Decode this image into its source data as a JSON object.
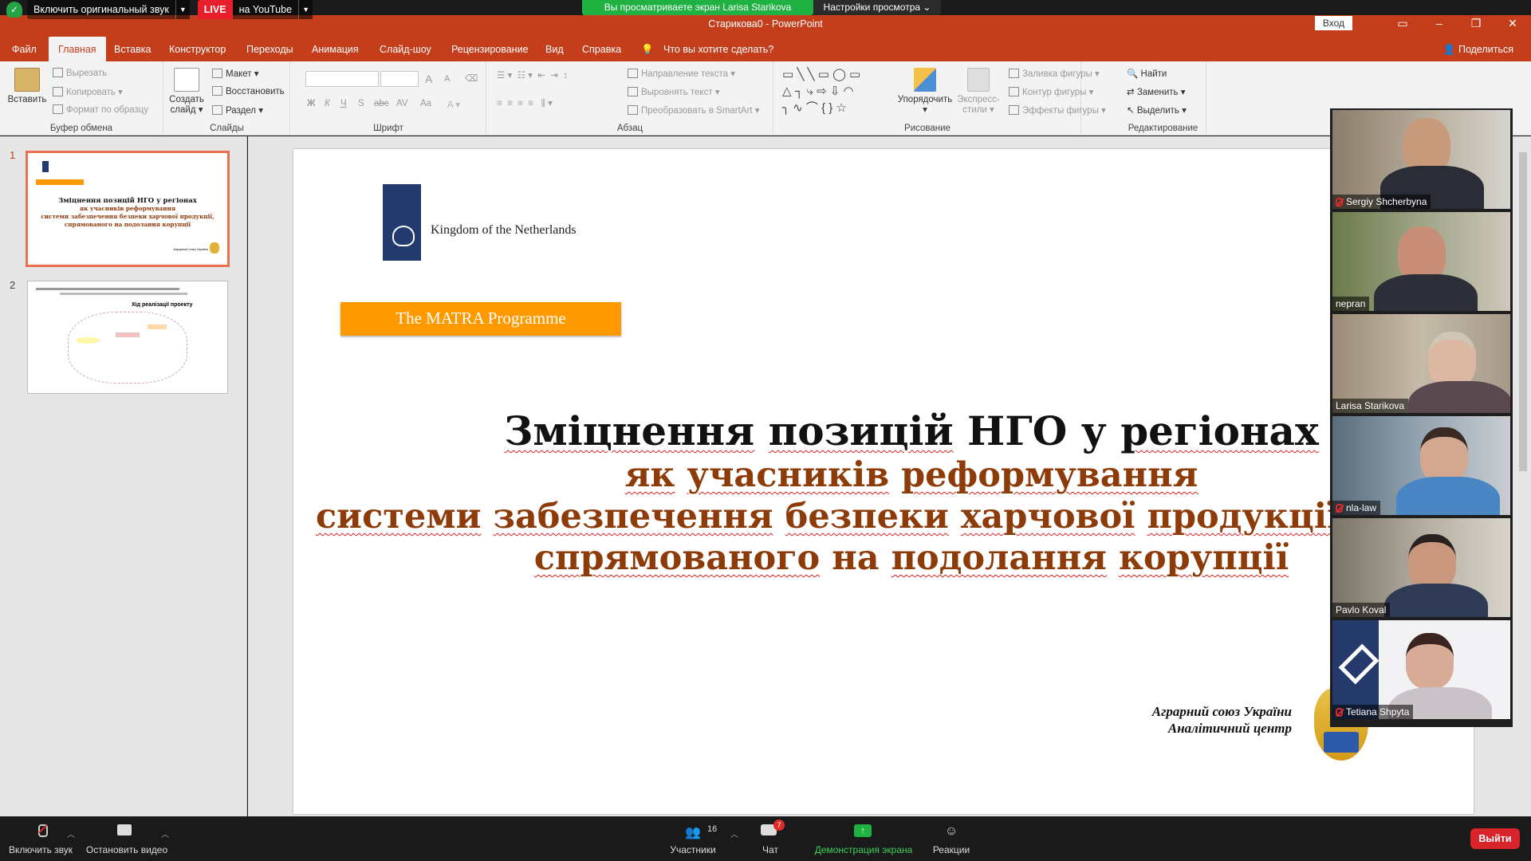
{
  "zoom_banner": {
    "viewing": "Вы просматриваете экран Larisa Starikova",
    "view_options": "Настройки просмотра"
  },
  "zoom_overlay": {
    "original_sound": "Включить оригинальный звук",
    "live": "LIVE",
    "youtube": "на YouTube"
  },
  "titlebar": {
    "doc_title": "Старикова0  -  PowerPoint",
    "signin": "Вход",
    "right_cut": "Вид"
  },
  "tabs": [
    {
      "label": "Файл"
    },
    {
      "label": "Главная"
    },
    {
      "label": "Вставка"
    },
    {
      "label": "Конструктор"
    },
    {
      "label": "Переходы"
    },
    {
      "label": "Анимация"
    },
    {
      "label": "Слайд-шоу"
    },
    {
      "label": "Рецензирование"
    },
    {
      "label": "Вид"
    },
    {
      "label": "Справка"
    },
    {
      "label": "Что вы хотите сделать?"
    }
  ],
  "share": "Поделиться",
  "ribbon": {
    "clipboard": {
      "label": "Буфер обмена",
      "paste": "Вставить",
      "cut": "Вырезать",
      "copy": "Копировать",
      "format": "Формат по образцу"
    },
    "slides": {
      "label": "Слайды",
      "new_slide": "Создать слайд",
      "layout": "Макет",
      "reset": "Восстановить",
      "section": "Раздел"
    },
    "font": {
      "label": "Шрифт",
      "bold": "Ж",
      "italic": "К",
      "underline": "Ч",
      "shadow": "S",
      "strike": "abc",
      "spacing": "AV",
      "case": "Aa",
      "grow": "A",
      "shrink": "A"
    },
    "paragraph": {
      "label": "Абзац",
      "direction": "Направление текста",
      "align": "Выровнять текст",
      "smartart": "Преобразовать в SmartArt"
    },
    "drawing": {
      "label": "Рисование",
      "arrange": "Упорядочить",
      "styles": "Экспресс-стили",
      "fill": "Заливка фигуры",
      "outline": "Контур фигуры",
      "effects": "Эффекты фигуры"
    },
    "editing": {
      "label": "Редактирование",
      "find": "Найти",
      "replace": "Заменить",
      "select": "Выделить"
    }
  },
  "thumbnails": [
    {
      "num": "1",
      "title": "Зміцнення позицій НГО у регіонах",
      "sub1": "як учасників реформування",
      "sub2": "системи забезпечення безпеки харчової продукції,",
      "sub3": "спрямованого на подолання корупції",
      "org": "Аграрний союз України"
    },
    {
      "num": "2",
      "text": "Хід реалізації проекту"
    }
  ],
  "slide": {
    "nl_text": "Kingdom of the Netherlands",
    "matra": "The MATRA Programme",
    "title_w": [
      "Зміцнення",
      "позицій",
      "НГО",
      "у",
      "регіонах"
    ],
    "line2_w": [
      "як",
      "учасників",
      "реформування"
    ],
    "line3_w": [
      "системи",
      "забезпечення",
      "безпеки",
      "харчової",
      "продукції,"
    ],
    "line4_w": [
      "спрямованого",
      "на",
      "подолання",
      "корупції"
    ],
    "org1": "Аграрний союз України",
    "org2": "Аналітичний центр"
  },
  "participants": [
    {
      "name": "Sergiy Shcherbyna",
      "muted": true
    },
    {
      "name": "nepran",
      "muted": false
    },
    {
      "name": "Larisa Starikova",
      "muted": false
    },
    {
      "name": "nla-law",
      "muted": true
    },
    {
      "name": "Pavlo Koval",
      "muted": false
    },
    {
      "name": "Tetiana Shpyta",
      "muted": true
    }
  ],
  "zoom_toolbar": {
    "unmute": "Включить звук",
    "start_video": "Остановить видео",
    "participants": "Участники",
    "participants_count": "16",
    "chat": "Чат",
    "chat_badge": "7",
    "share": "Демонстрация экрана",
    "reactions": "Реакции",
    "leave": "Выйти"
  },
  "colors": {
    "ppt_accent": "#c43e1c",
    "zoom_green": "#1fb141",
    "title_brown": "#8e3b0a",
    "matra_orange": "#ff9900",
    "leave_red": "#d8232a"
  }
}
